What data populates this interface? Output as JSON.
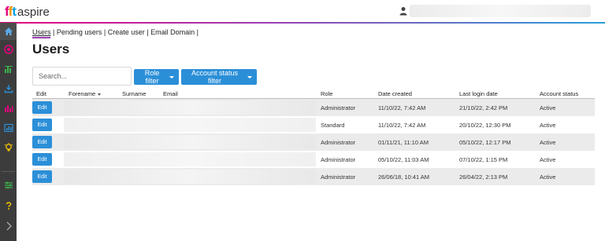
{
  "app": {
    "logo_brand": "fft",
    "logo_product": "aspire"
  },
  "header": {
    "user_icon": "user-icon"
  },
  "sidebar": {
    "items": [
      {
        "name": "home-icon",
        "color": "#5aa9e6"
      },
      {
        "name": "target-icon",
        "color": "#e6007e"
      },
      {
        "name": "chart-icon",
        "color": "#3cb44b"
      },
      {
        "name": "download-icon",
        "color": "#2b8fd8"
      },
      {
        "name": "bar-chart-icon",
        "color": "#e6007e"
      },
      {
        "name": "report-icon",
        "color": "#2b8fd8"
      },
      {
        "name": "lightbulb-icon",
        "color": "#f5c400"
      },
      {
        "name": "sliders-icon",
        "color": "#3cb44b"
      },
      {
        "name": "help-icon",
        "color": "#f5c400"
      },
      {
        "name": "expand-icon",
        "color": "#aaaaaa"
      }
    ]
  },
  "nav": {
    "users": "Users",
    "pending": "Pending users",
    "create": "Create user",
    "email_domain": "Email Domain",
    "sep": " | "
  },
  "page": {
    "title": "Users"
  },
  "search": {
    "placeholder": "Search..."
  },
  "filters": {
    "role": "Role filter",
    "status": "Account status filter"
  },
  "table": {
    "headers": {
      "edit": "Edit",
      "forename": "Forename",
      "surname": "Surname",
      "email": "Email",
      "role": "Role",
      "date_created": "Date created",
      "last_login": "Last login date",
      "status": "Account status"
    },
    "edit_label": "Edit",
    "rows": [
      {
        "role": "Administrator",
        "date_created": "11/10/22, 7:42 AM",
        "last_login": "21/10/22, 2:42 PM",
        "status": "Active"
      },
      {
        "role": "Standard",
        "date_created": "11/10/22, 7:42 AM",
        "last_login": "20/10/22, 12:30 PM",
        "status": "Active"
      },
      {
        "role": "Administrator",
        "date_created": "01/11/21, 11:10 AM",
        "last_login": "05/10/22, 12:17 PM",
        "status": "Active"
      },
      {
        "role": "Administrator",
        "date_created": "05/10/22, 11:03 AM",
        "last_login": "07/10/22, 1:15 PM",
        "status": "Active"
      },
      {
        "role": "Administrator",
        "date_created": "26/06/18, 10:41 AM",
        "last_login": "26/04/22, 2:13 PM",
        "status": "Active"
      }
    ]
  },
  "colors": {
    "accent": "#2b8fd8",
    "brand_pink": "#e6007e",
    "sidebar_bg": "#3c3c3c"
  }
}
